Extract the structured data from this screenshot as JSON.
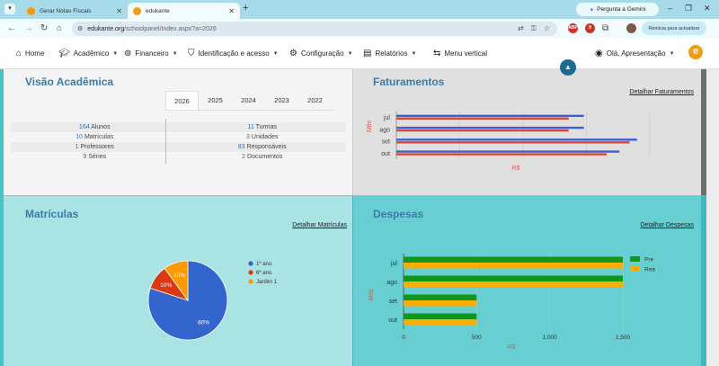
{
  "browser": {
    "tabs": [
      {
        "title": "Gerar Notas Fiscais",
        "active": false
      },
      {
        "title": "edukante",
        "active": true
      }
    ],
    "gemini_label": "Pergunta a Gemini",
    "url_host": "edukante.org",
    "url_path": "/schoolpanel/Index.aspx?a=2026",
    "relaunch_label": "Reinicia para actualizar",
    "extension_badges": [
      "ABP",
      "8"
    ]
  },
  "nav": {
    "items": [
      {
        "label": "Home",
        "icon": "home-icon",
        "dropdown": false
      },
      {
        "label": "Acadêmico",
        "icon": "graduation-cap-icon",
        "dropdown": true
      },
      {
        "label": "Financeiro",
        "icon": "coins-icon",
        "dropdown": true
      },
      {
        "label": "Identificação e acesso",
        "icon": "shield-icon",
        "dropdown": true
      },
      {
        "label": "Configuração",
        "icon": "gear-icon",
        "dropdown": true
      },
      {
        "label": "Relatórios",
        "icon": "report-icon",
        "dropdown": true
      },
      {
        "label": "Menu vertical",
        "icon": "swap-arrows-icon",
        "dropdown": false
      }
    ],
    "user_label": "Olá, Apresentação",
    "logo_letter": "e"
  },
  "academic": {
    "title": "Visão Acadêmica",
    "years": [
      "2026",
      "2025",
      "2024",
      "2023",
      "2022"
    ],
    "active_year": "2026",
    "stats": [
      {
        "left_num": "164",
        "left_label": "Alunos",
        "right_num": "11",
        "right_label": "Turmas"
      },
      {
        "left_num": "10",
        "left_label": "Matrículas",
        "right_num": "3",
        "right_label": "Unidades"
      },
      {
        "left_num": "1",
        "left_label": "Professores",
        "right_num": "83",
        "right_label": "Responsáveis"
      },
      {
        "left_num": "9",
        "left_label": "Séries",
        "right_num": "2",
        "right_label": "Documentos"
      }
    ]
  },
  "billing": {
    "title": "Faturamentos",
    "detail_link": "Detalhar Faturamentos"
  },
  "enrollments": {
    "title": "Matrículas",
    "detail_link": "Detalhar Matrículas"
  },
  "expenses": {
    "title": "Despesas",
    "detail_link": "Detalhar Despesas"
  },
  "colors": {
    "title_blue": "#3a7ca5",
    "bar_blue": "#3f5fd0",
    "bar_red": "#d9473a",
    "pie_blue": "#3366cc",
    "pie_red": "#dc3912",
    "pie_orange": "#ff9900",
    "bar_green": "#109618",
    "bar_yellow": "#ffab00",
    "axis_label_red": "#e05a4a"
  },
  "chart_data": [
    {
      "id": "billing",
      "type": "bar",
      "orientation": "horizontal",
      "categories": [
        "jul",
        "ago",
        "set",
        "out"
      ],
      "series": [
        {
          "values": [
            0.74,
            0.74,
            0.95,
            0.88
          ]
        },
        {
          "values": [
            0.68,
            0.68,
            0.92,
            0.83
          ]
        }
      ],
      "xlabel": "R$",
      "ylabel": "Mês",
      "xlim": [
        0,
        1
      ],
      "tick_labels_shown": false,
      "grid": true
    },
    {
      "id": "enrollments",
      "type": "pie",
      "labels": [
        "1º ano",
        "6º ano",
        "Jardim 1"
      ],
      "values": [
        80,
        10,
        10
      ],
      "value_labels": [
        "80%",
        "10%",
        "10%"
      ],
      "legend": "right"
    },
    {
      "id": "expenses",
      "type": "bar",
      "orientation": "horizontal",
      "categories": [
        "jul",
        "ago",
        "set",
        "out"
      ],
      "series": [
        {
          "name": "Pre",
          "values": [
            1500,
            1500,
            500,
            500
          ]
        },
        {
          "name": "Rea",
          "values": [
            1500,
            1500,
            500,
            500
          ]
        }
      ],
      "xlabel": "R$",
      "ylabel": "Mês",
      "xlim": [
        0,
        1500
      ],
      "xticks": [
        0,
        500,
        1000,
        1500
      ],
      "xtick_labels": [
        "0",
        "500",
        "1,000",
        "1,500"
      ],
      "grid": true,
      "legend": "top-right"
    }
  ]
}
